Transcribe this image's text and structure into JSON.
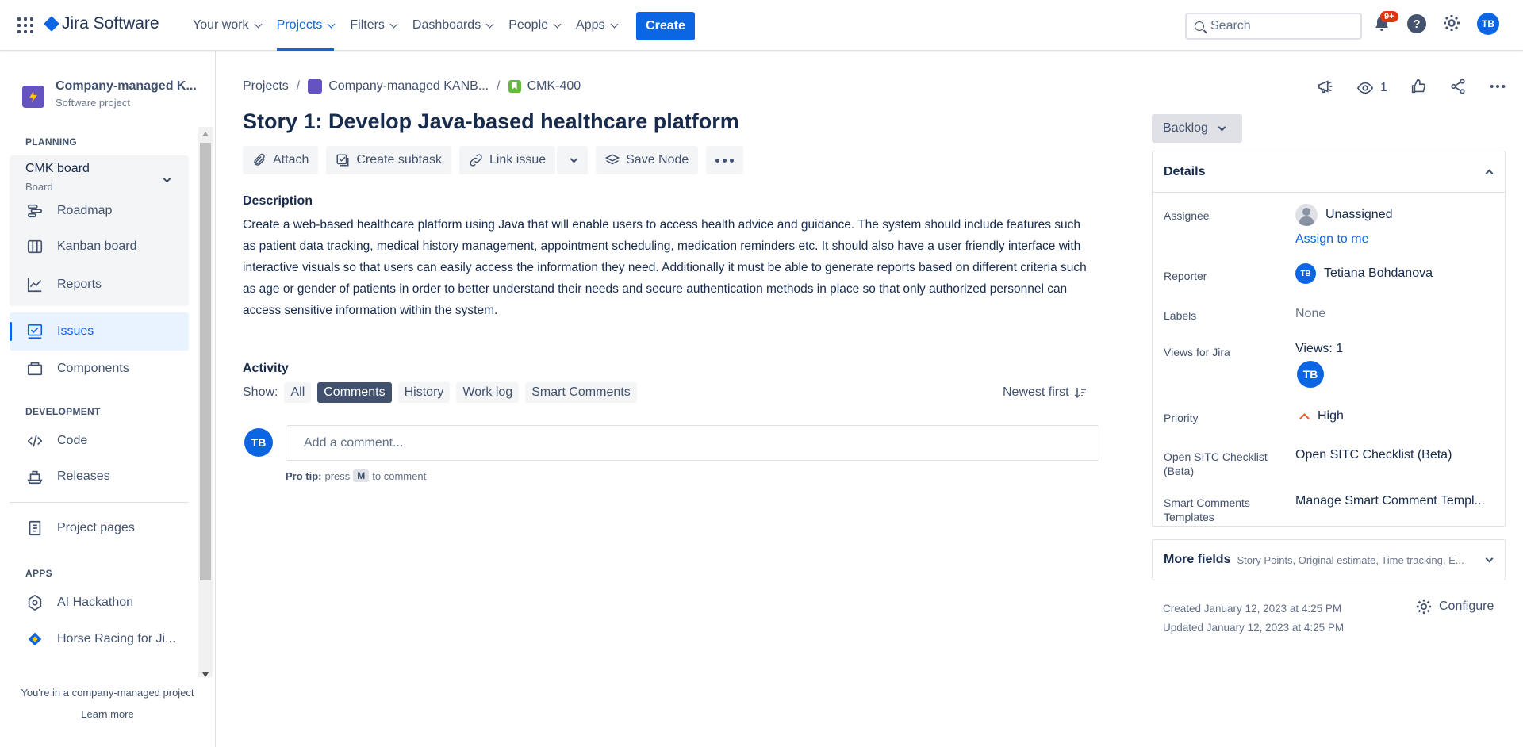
{
  "topnav": {
    "app_name": "Jira Software",
    "items": [
      {
        "label": "Your work",
        "active": false
      },
      {
        "label": "Projects",
        "active": true
      },
      {
        "label": "Filters",
        "active": false
      },
      {
        "label": "Dashboards",
        "active": false
      },
      {
        "label": "People",
        "active": false
      },
      {
        "label": "Apps",
        "active": false
      }
    ],
    "create_label": "Create",
    "search_placeholder": "Search",
    "notifications_badge": "9+",
    "user_initials": "TB"
  },
  "sidebar": {
    "project_name": "Company-managed K...",
    "project_type": "Software project",
    "planning_title": "PLANNING",
    "board_name": "CMK board",
    "board_sub": "Board",
    "planning_items": [
      {
        "label": "Roadmap",
        "icon": "roadmap-icon"
      },
      {
        "label": "Kanban board",
        "icon": "kanban-icon"
      },
      {
        "label": "Reports",
        "icon": "reports-icon"
      }
    ],
    "issues_label": "Issues",
    "components_label": "Components",
    "development_title": "DEVELOPMENT",
    "dev_items": [
      {
        "label": "Code",
        "icon": "code-icon"
      },
      {
        "label": "Releases",
        "icon": "releases-icon"
      }
    ],
    "project_pages_label": "Project pages",
    "apps_title": "APPS",
    "app_items": [
      {
        "label": "AI Hackathon",
        "icon": "hackathon-icon"
      },
      {
        "label": "Horse Racing for Ji...",
        "icon": "horse-racing-icon"
      }
    ],
    "footer_text": "You're in a company-managed project",
    "footer_link": "Learn more"
  },
  "breadcrumb": {
    "root": "Projects",
    "project": "Company-managed KANB...",
    "issue_key": "CMK-400"
  },
  "watchers_count": "1",
  "issue": {
    "title": "Story 1: Develop Java-based healthcare platform",
    "toolbar": {
      "attach": "Attach",
      "create_subtask": "Create subtask",
      "link_issue": "Link issue",
      "save_node": "Save Node"
    },
    "description_label": "Description",
    "description": " Create a web-based healthcare platform using Java that will enable users to access health advice and guidance. The system should include features such as patient data tracking, medical history management, appointment scheduling, medication reminders etc. It should also have a user friendly interface with interactive visuals so that users can easily access the information they need. Additionally it must be able to generate reports based on different criteria such as age or gender of patients in order to better understand their needs and secure authentication methods in place so that only authorized personnel can access sensitive information within the system."
  },
  "activity": {
    "label": "Activity",
    "show_label": "Show:",
    "filters": [
      {
        "label": "All",
        "active": false
      },
      {
        "label": "Comments",
        "active": true
      },
      {
        "label": "History",
        "active": false
      },
      {
        "label": "Work log",
        "active": false
      },
      {
        "label": "Smart Comments",
        "active": false
      }
    ],
    "sort_label": "Newest first",
    "comment_avatar": "TB",
    "comment_placeholder": "Add a comment...",
    "pro_tip_label": "Pro tip:",
    "pro_tip_press": "press",
    "pro_tip_key": "M",
    "pro_tip_suffix": "to comment"
  },
  "details_panel": {
    "status": "Backlog",
    "header": "Details",
    "assignee_label": "Assignee",
    "assignee_value": "Unassigned",
    "assign_to_me": "Assign to me",
    "reporter_label": "Reporter",
    "reporter_initials": "TB",
    "reporter_name": "Tetiana Bohdanova",
    "labels_label": "Labels",
    "labels_value": "None",
    "views_label": "Views for Jira",
    "views_value": "Views: 1",
    "views_avatar": "TB",
    "priority_label": "Priority",
    "priority_value": "High",
    "sitc_label": "Open SITC Checklist (Beta)",
    "sitc_value": "Open SITC Checklist (Beta)",
    "smart_label": "Smart Comments Templates",
    "smart_value": "Manage Smart Comment Templ...",
    "more_fields_title": "More fields",
    "more_fields_sub": "Story Points, Original estimate, Time tracking, E...",
    "created": "Created January 12, 2023 at 4:25 PM",
    "updated": "Updated January 12, 2023 at 4:25 PM",
    "configure": "Configure"
  },
  "colors": {
    "brand": "#0c66e4",
    "active_bg": "#e9f2ff",
    "badge": "#de350b",
    "priority_high": "#ff5630"
  }
}
